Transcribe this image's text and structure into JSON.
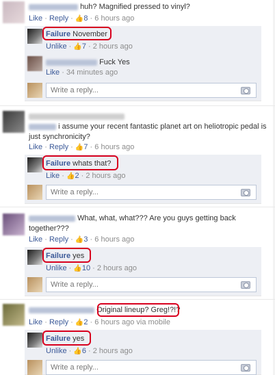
{
  "common": {
    "like": "Like",
    "reply": "Reply",
    "unlike": "Unlike",
    "dot": "·",
    "write_placeholder": "Write a reply..."
  },
  "threads": [
    {
      "text": "huh? Magnified pressed to vinyl?",
      "likes": "8",
      "time": "6 hours ago",
      "replies": [
        {
          "name": "Failure",
          "text": "November",
          "likes": "7",
          "time": "2 hours ago",
          "action": "Unlike"
        },
        {
          "name": "",
          "text": "Fuck Yes",
          "likes": "",
          "time": "34 minutes ago",
          "action": "Like"
        }
      ]
    },
    {
      "text": "i assume your recent fantastic planet art on heliotropic pedal is just synchronicity?",
      "likes": "7",
      "time": "6 hours ago",
      "replies": [
        {
          "name": "Failure",
          "text": "whats that?",
          "likes": "2",
          "time": "2 hours ago",
          "action": "Like"
        }
      ]
    },
    {
      "text": "What, what, what??? Are you guys getting back together???",
      "likes": "3",
      "time": "6 hours ago",
      "replies": [
        {
          "name": "Failure",
          "text": "yes",
          "likes": "10",
          "time": "2 hours ago",
          "action": "Unlike"
        }
      ]
    },
    {
      "text": "Original lineup? Greg!?!?",
      "likes": "2",
      "time": "6 hours ago via mobile",
      "replies": [
        {
          "name": "Failure",
          "text": "yes",
          "likes": "6",
          "time": "2 hours ago",
          "action": "Unlike"
        }
      ]
    }
  ]
}
